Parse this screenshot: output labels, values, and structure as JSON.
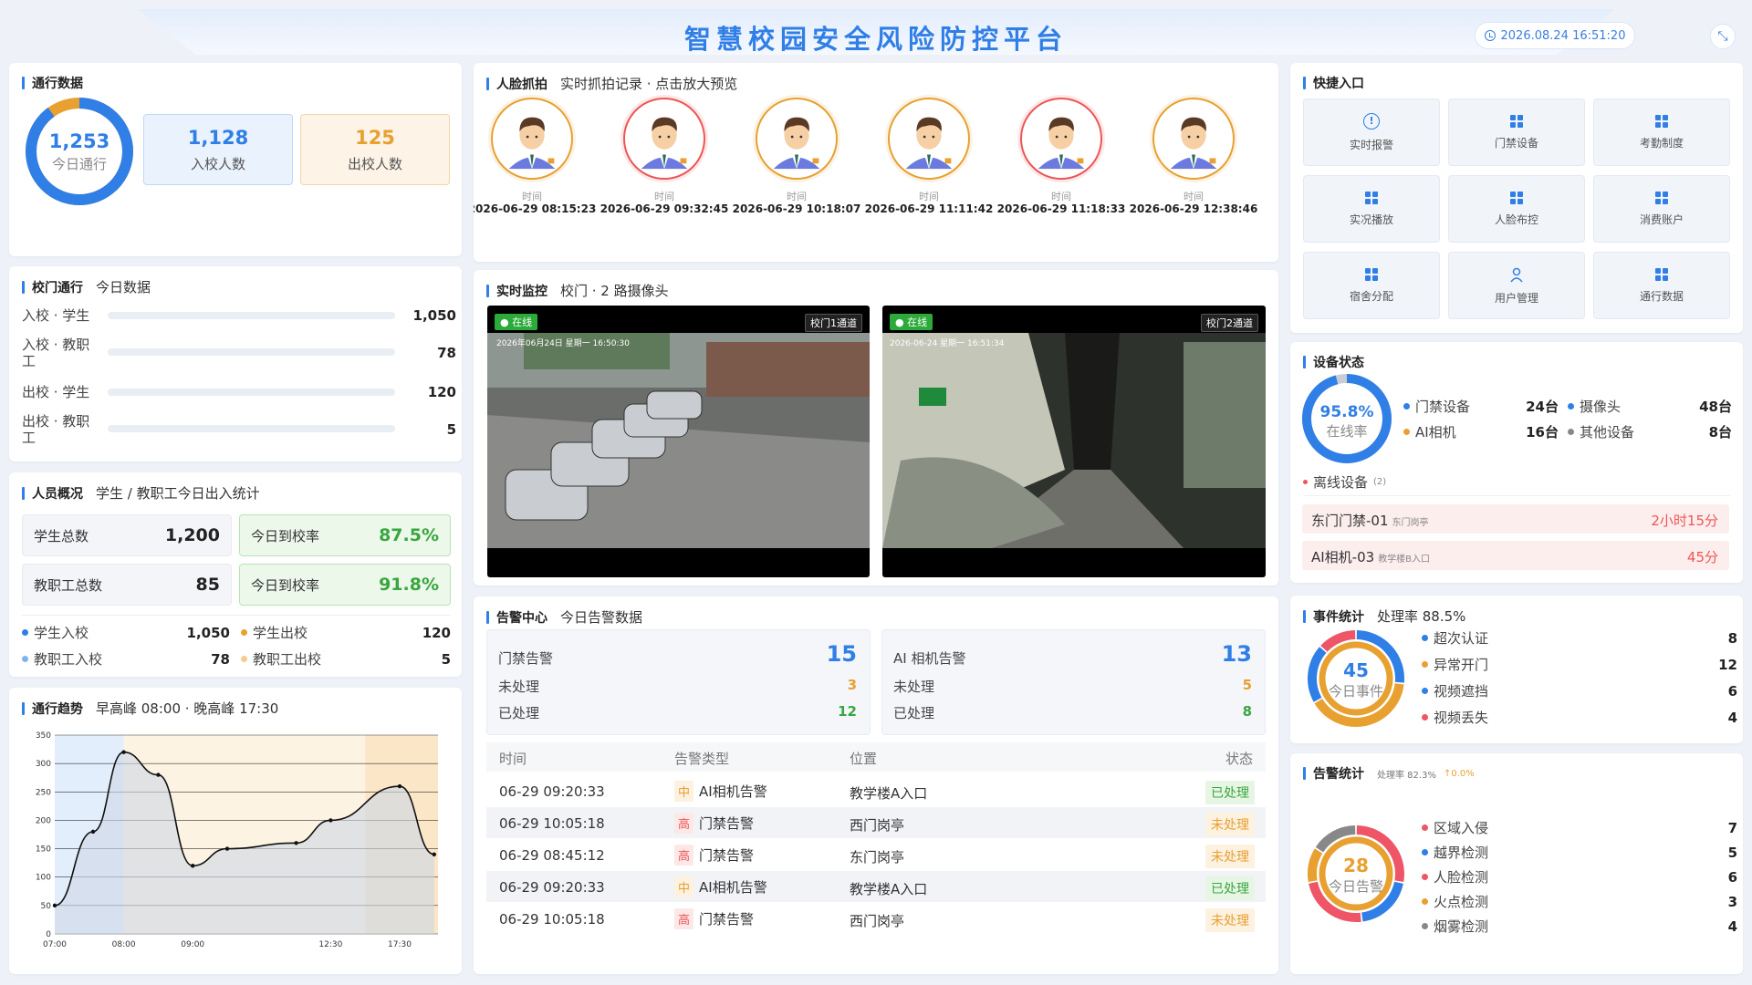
{
  "header": {
    "title": "智慧校园安全风险防控平台",
    "datetime": "2026.08.24 16:51:20",
    "fullscreen_icon": "collapse-icon"
  },
  "traffic": {
    "title": "通行数据",
    "today_value": "1,253",
    "today_label": "今日通行",
    "in_value": "1,128",
    "in_label": "入校人数",
    "out_value": "125",
    "out_label": "出校人数",
    "in_ratio": 0.9,
    "colors": {
      "blue": "#2f7fe6",
      "orange": "#e8a030"
    }
  },
  "gate": {
    "title": "校门通行",
    "subtitle": "今日数据",
    "rows": [
      {
        "label": "入校 · 学生",
        "value": "1,050"
      },
      {
        "label": "入校 · 教职工",
        "value": "78"
      },
      {
        "label": "出校 · 学生",
        "value": "120"
      },
      {
        "label": "出校 · 教职工",
        "value": "5"
      }
    ]
  },
  "people": {
    "title": "人员概况",
    "subtitle": "学生 / 教职工今日出入统计",
    "student_total_label": "学生总数",
    "student_total": "1,200",
    "student_rate_label": "今日到校率",
    "student_rate": "87.5%",
    "staff_total_label": "教职工总数",
    "staff_total": "85",
    "staff_rate_label": "今日到校率",
    "staff_rate": "91.8%",
    "legend": [
      {
        "label": "学生入校",
        "value": "1,050",
        "color": "#2f7fe6"
      },
      {
        "label": "学生出校",
        "value": "120",
        "color": "#e8a030"
      },
      {
        "label": "教职工入校",
        "value": "78",
        "color": "#7fb3f0"
      },
      {
        "label": "教职工出校",
        "value": "5",
        "color": "#f3cd8f"
      }
    ]
  },
  "trend": {
    "title": "通行趋势",
    "subtitle": "早高峰 08:00 · 晚高峰 17:30"
  },
  "chart_data": {
    "type": "area",
    "x": [
      "07:00",
      "07:30",
      "08:00",
      "08:30",
      "09:00",
      "09:30",
      "10:30",
      "11:30",
      "12:30",
      "16:30",
      "17:30",
      "18:00"
    ],
    "xticks": [
      "07:00",
      "08:00",
      "09:00",
      "12:30",
      "17:30"
    ],
    "values": [
      50,
      180,
      320,
      280,
      120,
      150,
      160,
      200,
      260,
      140
    ],
    "y": [
      50,
      180,
      320,
      280,
      120,
      150,
      160,
      200,
      260,
      140
    ],
    "ylim": [
      0,
      350
    ],
    "yticks": [
      0,
      50,
      100,
      150,
      200,
      250,
      300,
      350
    ],
    "grid": true
  },
  "faces": {
    "title": "人脸抓拍",
    "subtitle": "实时抓拍记录 · 点击放大预览",
    "caption": "时间",
    "items": [
      {
        "time": "2026-06-29 08:15:23",
        "ring": "#e8a030"
      },
      {
        "time": "2026-06-29 09:32:45",
        "ring": "#ee5555"
      },
      {
        "time": "2026-06-29 10:18:07",
        "ring": "#e8a030"
      },
      {
        "time": "2026-06-29 11:11:42",
        "ring": "#e8a030"
      },
      {
        "time": "2026-06-29 11:18:33",
        "ring": "#ee5555"
      },
      {
        "time": "2026-06-29 12:38:46",
        "ring": "#e8a030"
      }
    ]
  },
  "monitor": {
    "title": "实时监控",
    "subtitle": "校门 · 2 路摄像头",
    "cams": [
      {
        "status": "● 在线",
        "channel": "校门1通道",
        "osd": "2026年06月24日 星期一 16:50:30"
      },
      {
        "status": "● 在线",
        "channel": "校门2通道",
        "osd": "2026-06-24 星期一 16:51:34"
      }
    ]
  },
  "alerts": {
    "title": "告警中心",
    "subtitle": "今日告警数据",
    "boxes": [
      {
        "name": "门禁告警",
        "total": "15",
        "pending_label": "未处理",
        "pending": "3",
        "done_label": "已处理",
        "done": "12"
      },
      {
        "name": "AI 相机告警",
        "total": "13",
        "pending_label": "未处理",
        "pending": "5",
        "done_label": "已处理",
        "done": "8"
      }
    ],
    "columns": [
      "时间",
      "告警类型",
      "位置",
      "状态"
    ],
    "rows": [
      {
        "time": "06-29 09:20:33",
        "level": "中",
        "type": "AI相机告警",
        "location": "教学楼A入口",
        "status": "已处理"
      },
      {
        "time": "06-29 10:05:18",
        "level": "高",
        "type": "门禁告警",
        "location": "西门岗亭",
        "status": "未处理"
      },
      {
        "time": "06-29 08:45:12",
        "level": "高",
        "type": "门禁告警",
        "location": "东门岗亭",
        "status": "未处理"
      },
      {
        "time": "06-29 09:20:33",
        "level": "中",
        "type": "AI相机告警",
        "location": "教学楼A入口",
        "status": "已处理"
      },
      {
        "time": "06-29 10:05:18",
        "level": "高",
        "type": "门禁告警",
        "location": "西门岗亭",
        "status": "未处理"
      }
    ]
  },
  "quick": {
    "title": "快捷入口",
    "items": [
      {
        "label": "实时报警",
        "icon": "alert-circle-icon"
      },
      {
        "label": "门禁设备",
        "icon": "grid-icon"
      },
      {
        "label": "考勤制度",
        "icon": "grid-icon"
      },
      {
        "label": "实况播放",
        "icon": "grid-icon"
      },
      {
        "label": "人脸布控",
        "icon": "grid-icon"
      },
      {
        "label": "消费账户",
        "icon": "grid-icon"
      },
      {
        "label": "宿舍分配",
        "icon": "grid-icon"
      },
      {
        "label": "用户管理",
        "icon": "user-icon"
      },
      {
        "label": "通行数据",
        "icon": "grid-icon"
      }
    ]
  },
  "devices": {
    "title": "设备状态",
    "online_rate": "95.8%",
    "online_label": "在线率",
    "online_ratio": 0.958,
    "items": [
      {
        "label": "门禁设备",
        "value": "24台",
        "color": "#2f7fe6"
      },
      {
        "label": "摄像头",
        "value": "48台",
        "color": "#2f7fe6"
      },
      {
        "label": "AI相机",
        "value": "16台",
        "color": "#e8a030"
      },
      {
        "label": "其他设备",
        "value": "8台",
        "color": "#888888"
      }
    ],
    "offline_label": "离线设备",
    "offline_count": "(2)",
    "offline": [
      {
        "name": "东门门禁-01",
        "loc": "东门岗亭",
        "duration": "2小时15分"
      },
      {
        "name": "AI相机-03",
        "loc": "教学楼B入口",
        "duration": "45分"
      }
    ]
  },
  "events": {
    "title": "事件统计",
    "subtitle": "处理率 88.5%",
    "total": "45",
    "total_label": "今日事件",
    "items": [
      {
        "label": "超次认证",
        "value": "8",
        "color": "#2f7fe6"
      },
      {
        "label": "异常开门",
        "value": "12",
        "color": "#e8a030"
      },
      {
        "label": "视频遮挡",
        "value": "6",
        "color": "#2f7fe6"
      },
      {
        "label": "视频丢失",
        "value": "4",
        "color": "#ee5566"
      }
    ]
  },
  "alarm_stats": {
    "title": "告警统计",
    "rate": "处理率 82.3%",
    "change": "↑0.0%",
    "total": "28",
    "total_label": "今日告警",
    "items": [
      {
        "label": "区域入侵",
        "value": "7",
        "color": "#ee5566"
      },
      {
        "label": "越界检测",
        "value": "5",
        "color": "#2f7fe6"
      },
      {
        "label": "人脸检测",
        "value": "6",
        "color": "#ee5566"
      },
      {
        "label": "火点检测",
        "value": "3",
        "color": "#e8a030"
      },
      {
        "label": "烟雾检测",
        "value": "4",
        "color": "#888888"
      }
    ]
  }
}
